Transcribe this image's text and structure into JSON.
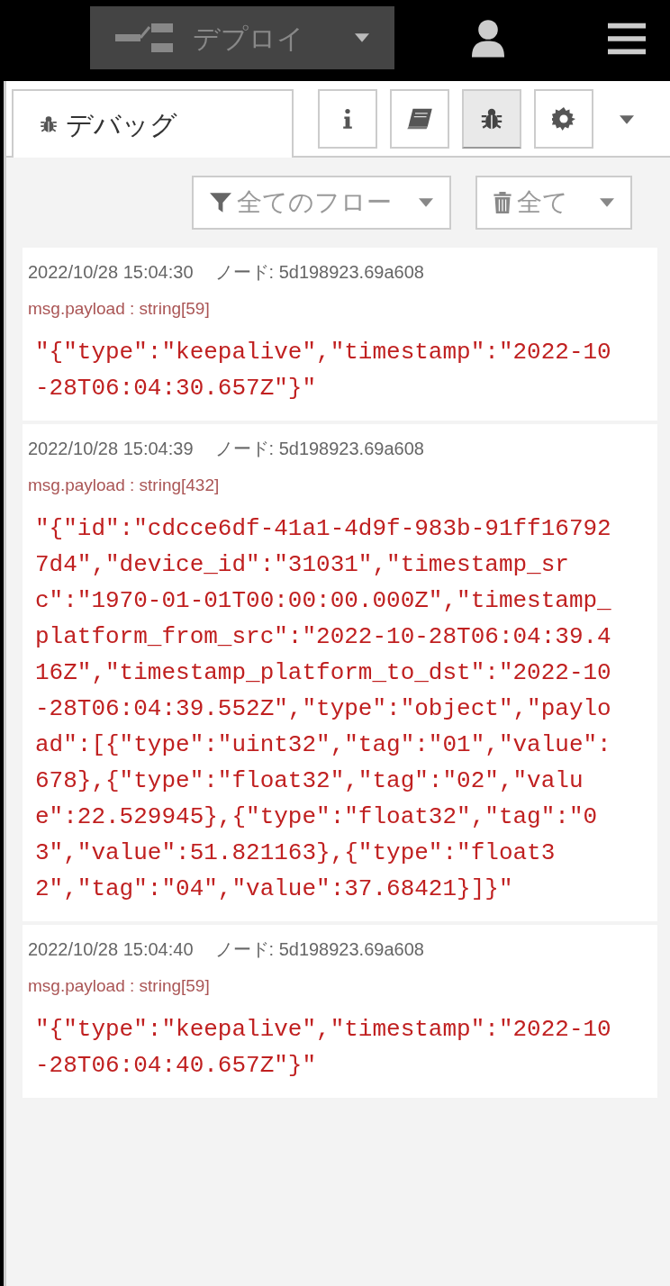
{
  "header": {
    "deploy_label": "デプロイ"
  },
  "sidebar": {
    "tab": {
      "label": "デバッグ",
      "selected": true
    },
    "tool_buttons": [
      {
        "kind": "info",
        "selected": false
      },
      {
        "kind": "book",
        "selected": false
      },
      {
        "kind": "bug",
        "selected": true
      },
      {
        "kind": "gear",
        "selected": false
      }
    ],
    "filter": {
      "label": "全てのフロー"
    },
    "clear": {
      "label": "全て"
    }
  },
  "messages": [
    {
      "time": "2022/10/28 15:04:30",
      "node": "ノード: 5d198923.69a608",
      "topic": "msg.payload : string[59]",
      "value": "\"{\"type\":\"keepalive\",\"timestamp\":\"2022-10-28T06:04:30.657Z\"}\""
    },
    {
      "time": "2022/10/28 15:04:39",
      "node": "ノード: 5d198923.69a608",
      "topic": "msg.payload : string[432]",
      "value": "\"{\"id\":\"cdcce6df-41a1-4d9f-983b-91ff167927d4\",\"device_id\":\"31031\",\"timestamp_src\":\"1970-01-01T00:00:00.000Z\",\"timestamp_platform_from_src\":\"2022-10-28T06:04:39.416Z\",\"timestamp_platform_to_dst\":\"2022-10-28T06:04:39.552Z\",\"type\":\"object\",\"payload\":[{\"type\":\"uint32\",\"tag\":\"01\",\"value\":678},{\"type\":\"float32\",\"tag\":\"02\",\"value\":22.529945},{\"type\":\"float32\",\"tag\":\"03\",\"value\":51.821163},{\"type\":\"float32\",\"tag\":\"04\",\"value\":37.68421}]}\""
    },
    {
      "time": "2022/10/28 15:04:40",
      "node": "ノード: 5d198923.69a608",
      "topic": "msg.payload : string[59]",
      "value": "\"{\"type\":\"keepalive\",\"timestamp\":\"2022-10-28T06:04:40.657Z\"}\""
    }
  ]
}
